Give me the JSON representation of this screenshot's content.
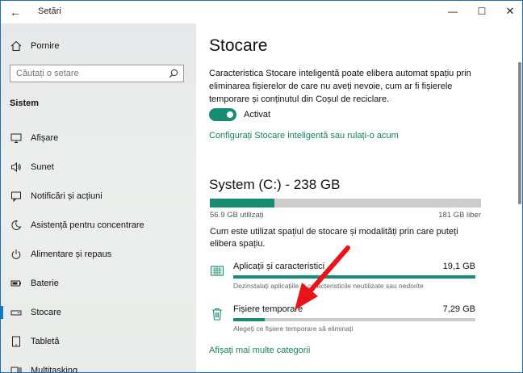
{
  "window": {
    "title": "Setări",
    "back_glyph": "←",
    "minimize_glyph": "—",
    "maximize_glyph": "☐",
    "close_glyph": "✕"
  },
  "sidebar": {
    "home_label": "Pornire",
    "search_placeholder": "Căutați o setare",
    "section_title": "Sistem",
    "items": [
      {
        "label": "Afișare",
        "icon": "monitor-icon"
      },
      {
        "label": "Sunet",
        "icon": "speaker-icon"
      },
      {
        "label": "Notificări și acțiuni",
        "icon": "notification-icon"
      },
      {
        "label": "Asistență pentru concentrare",
        "icon": "moon-icon"
      },
      {
        "label": "Alimentare și repaus",
        "icon": "power-icon"
      },
      {
        "label": "Baterie",
        "icon": "battery-icon"
      },
      {
        "label": "Stocare",
        "icon": "storage-icon",
        "active": true
      },
      {
        "label": "Tabletă",
        "icon": "tablet-icon"
      },
      {
        "label": "Multitasking",
        "icon": "multitasking-icon"
      }
    ]
  },
  "main": {
    "title": "Stocare",
    "description": "Caracteristica Stocare inteligentă poate elibera automat spațiu prin eliminarea fișierelor de care nu aveți nevoie, cum ar fi fișierele temporare și conținutul din Coșul de reciclare.",
    "toggle_label": "Activat",
    "toggle_on": true,
    "configure_link": "Configurați Stocare inteligentă sau rulați-o acum",
    "drive_title": "System (C:) - 238 GB",
    "drive_used_fraction": 0.239,
    "used_label": "56.9 GB utilizați",
    "free_label": "181 GB liber",
    "usage_description": "Cum este utilizat spațiul de stocare și modalități prin care puteți elibera spațiu.",
    "categories": [
      {
        "name": "Aplicații și caracteristici",
        "size": "19,1 GB",
        "fraction": 1.0,
        "subtitle": "Dezinstalați aplicațiile și caracteristicile neutilizate sau nedorite",
        "icon": "apps-icon"
      },
      {
        "name": "Fișiere temporare",
        "size": "7,29 GB",
        "fraction": 0.13,
        "subtitle": "Alegeți ce fișiere temporare să eliminați",
        "icon": "trash-icon"
      }
    ],
    "more_link": "Afișați mai multe categorii"
  },
  "colors": {
    "accent": "#178c73",
    "link": "#147f65",
    "annotation_arrow": "#e8141a",
    "active_marker": "#0b7fc4"
  }
}
